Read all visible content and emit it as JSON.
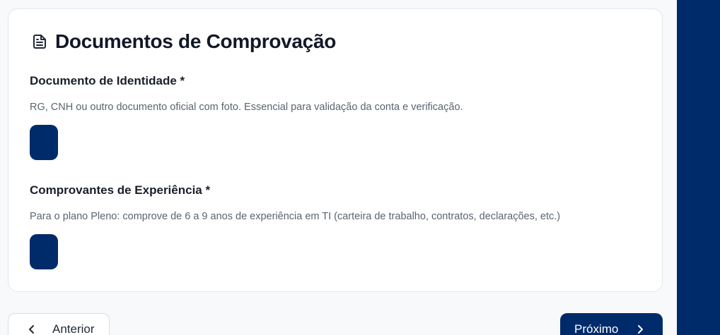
{
  "card": {
    "title": "Documentos de Comprovação",
    "icon": "document-icon"
  },
  "fields": [
    {
      "label": "Documento de Identidade *",
      "description": "RG, CNH ou outro documento oficial com foto. Essencial para validação da conta e verificação."
    },
    {
      "label": "Comprovantes de Experiência *",
      "description": "Para o plano Pleno: comprove de 6 a 9 anos de experiência em TI (carteira de trabalho, contratos, declarações, etc.)"
    }
  ],
  "navigation": {
    "previous_label": "Anterior",
    "next_label": "Próximo"
  },
  "colors": {
    "primary": "#002b6b",
    "card_background": "#ffffff",
    "page_background": "#f8f9fb"
  }
}
